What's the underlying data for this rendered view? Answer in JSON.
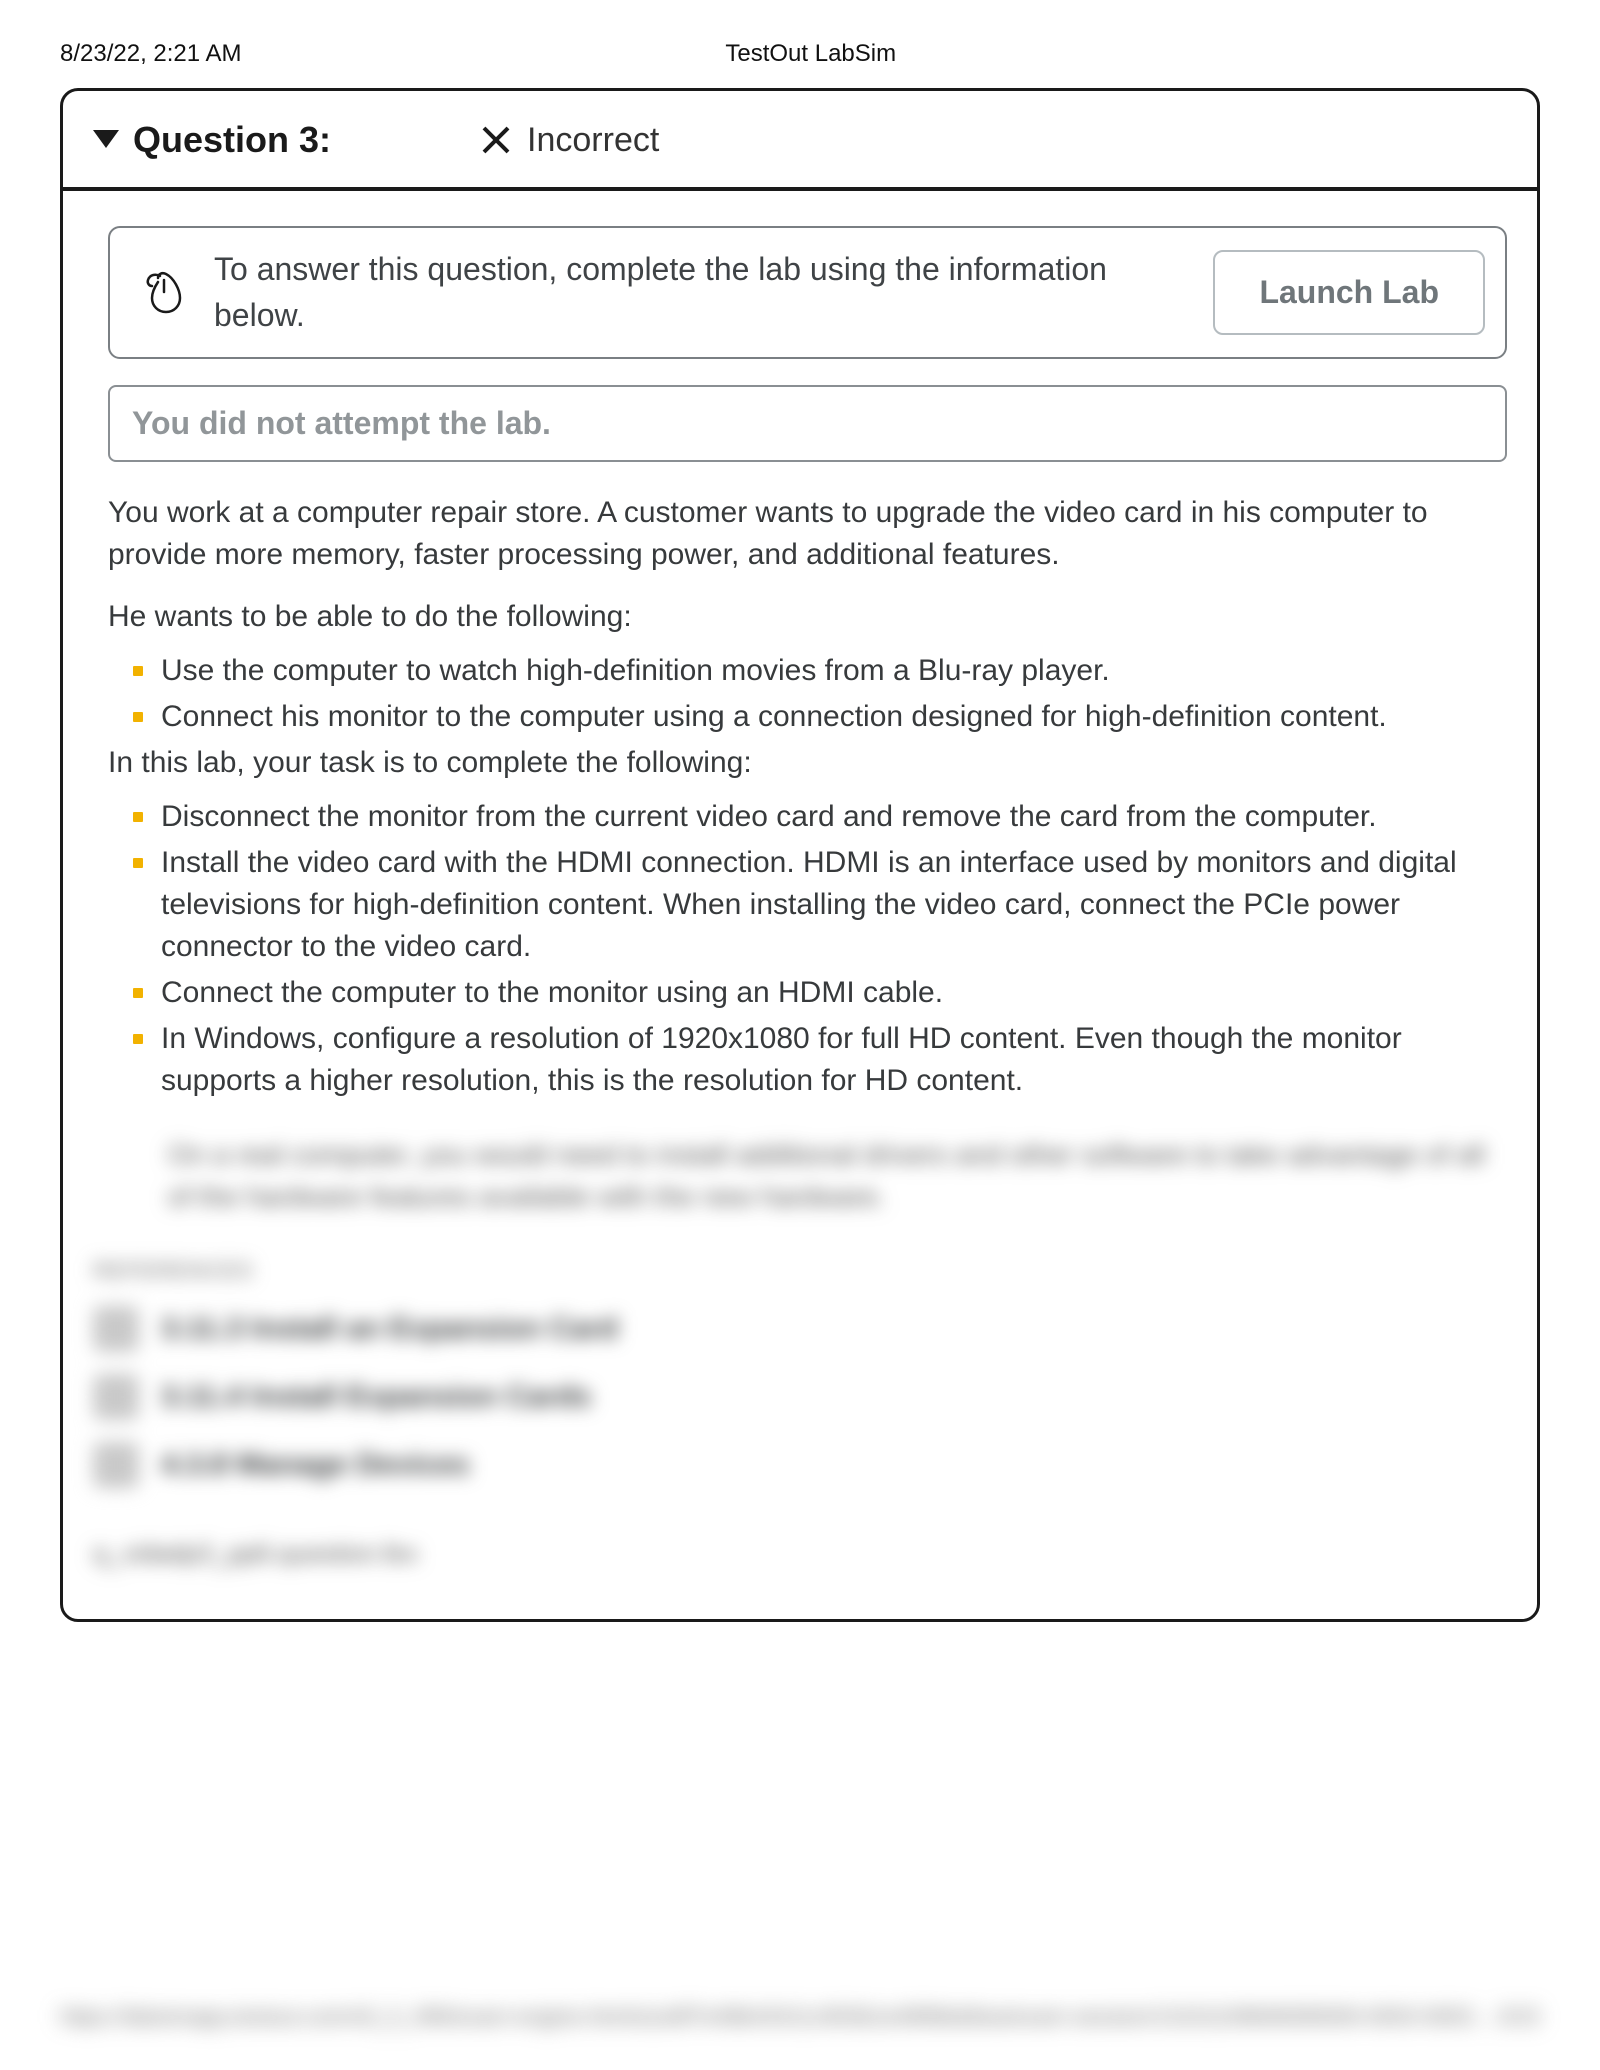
{
  "header": {
    "timestamp": "8/23/22, 2:21 AM",
    "title": "TestOut LabSim"
  },
  "question": {
    "label": "Question 3:",
    "status_text": "Incorrect"
  },
  "lab_banner": {
    "text": "To answer this question, complete the lab using the information below.",
    "button": "Launch Lab"
  },
  "attempt_msg": "You did not attempt the lab.",
  "paragraphs": {
    "intro": "You work at a computer repair store. A customer wants to upgrade the video card in his computer to provide more memory, faster processing power, and additional features.",
    "wants_lead": "He wants to be able to do the following:",
    "task_lead": "In this lab, your task is to complete the following:"
  },
  "wants_list": [
    "Use the computer to watch high-definition movies from a Blu-ray player.",
    "Connect his monitor to the computer using a connection designed for high-definition content."
  ],
  "tasks_list": [
    "Disconnect the monitor from the current video card and remove the card from the computer.",
    "Install the video card with the HDMI connection. HDMI is an interface used by monitors and digital televisions for high-definition content. When installing the video card, connect the PCIe power connector to the video card.",
    "Connect the computer to the monitor using an HDMI cable.",
    "In Windows, configure a resolution of 1920x1080 for full HD content. Even though the monitor supports a higher resolution, this is the resolution for HD content."
  ],
  "blurred": {
    "note": "On a real computer, you would need to install additional drivers and other software to take advantage of all of the hardware features available with the new hardware.",
    "references_label": "REFERENCES",
    "refs": [
      "3.11.3 Install an Expansion Card",
      "3.11.4 Install Expansion Cards",
      "4.3.8 Manage Devices"
    ],
    "filename": "q_vidadp3_pp6.question.fex"
  },
  "footer": {
    "url": "https://labsimapp.testout.com/v6_0_496/exam-engine.html/a1e8f7e48b43411c903b1e4898eb6ea/exam-session/13101109606090000-0003-0003…",
    "page": "3/15"
  }
}
